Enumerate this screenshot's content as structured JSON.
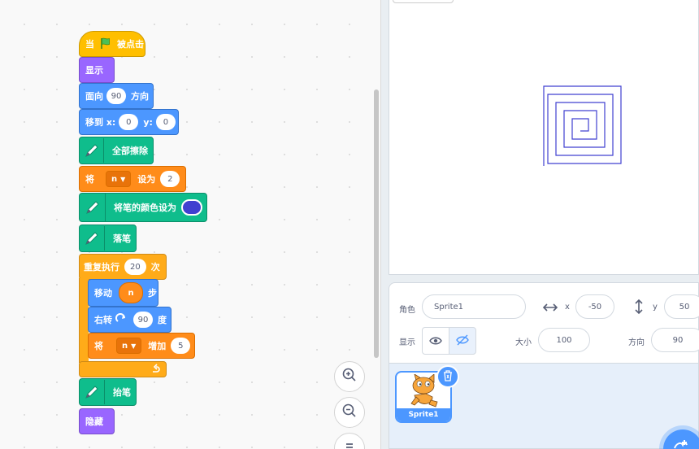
{
  "code": {
    "when_flag": {
      "when": "当",
      "clicked": "被点击"
    },
    "show": "显示",
    "point_dir": {
      "label": "面向",
      "value": "90",
      "suffix": "方向"
    },
    "goto": {
      "label": "移到 x:",
      "x": "0",
      "y_label": "y:",
      "y": "0"
    },
    "clear": "全部擦除",
    "set_var": {
      "label": "将",
      "var": "n",
      "to": "设为",
      "value": "2"
    },
    "set_pen_color": "将笔的颜色设为",
    "pen_down": "落笔",
    "repeat": {
      "label": "重复执行",
      "value": "20",
      "suffix": "次"
    },
    "move": {
      "label": "移动",
      "var": "n",
      "suffix": "步"
    },
    "turn_right": {
      "label": "右转",
      "value": "90",
      "suffix": "度"
    },
    "change_var": {
      "label": "将",
      "var": "n",
      "by": "增加",
      "value": "5"
    },
    "pen_up": "抬笔",
    "hide": "隐藏",
    "colors": {
      "events": "#ffbf00",
      "looks": "#9966ff",
      "motion": "#4c97ff",
      "pen": "#0fbd8c",
      "control": "#ffab19",
      "variables": "#ff8c1a",
      "pen_color": "#4040d0"
    }
  },
  "sprite_info": {
    "sprite_label": "角色",
    "sprite_name": "Sprite1",
    "x_label": "x",
    "x": "-50",
    "y_label": "y",
    "y": "50",
    "show_label": "显示",
    "size_label": "大小",
    "size": "100",
    "direction_label": "方向",
    "direction": "90"
  },
  "sprite_list": [
    {
      "name": "Sprite1"
    }
  ],
  "icons": [
    "green-flag-icon",
    "pen-icon",
    "turn-right-icon",
    "loop-arrow-icon",
    "zoom-in-icon",
    "zoom-out-icon",
    "zoom-reset-icon",
    "eye-icon",
    "eye-slash-icon",
    "trash-icon",
    "add-sprite-icon",
    "horizontal-arrows-icon",
    "vertical-arrows-icon"
  ]
}
